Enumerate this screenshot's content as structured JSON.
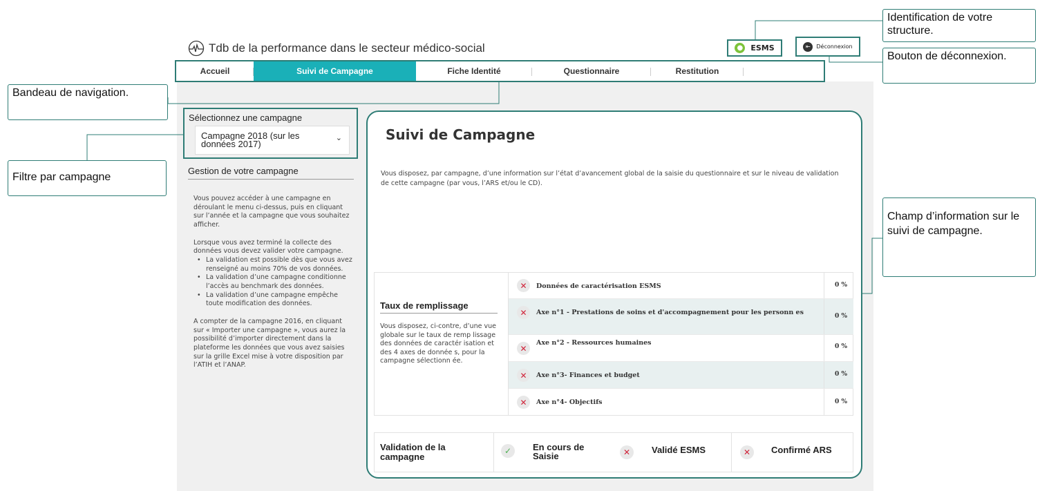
{
  "header": {
    "app_title": "Tdb de la performance dans le secteur médico-social",
    "esms_label": "ESMS",
    "logout_label": "Déconnexion"
  },
  "nav": {
    "tabs": [
      "Accueil",
      "Suivi de Campagne",
      "Fiche Identité",
      "Questionnaire",
      "Restitution"
    ],
    "active": "Suivi de Campagne"
  },
  "campaign_select": {
    "label": "Sélectionnez une campagne",
    "value": "Campagne 2018 (sur les données 2017)"
  },
  "gestion": {
    "title": "Gestion de votre campagne",
    "para1": "Vous pouvez accéder à une campagne en déroulant le menu ci-dessus, puis en cliquant sur l’année et la campagne que vous souhaitez afficher.",
    "para2": "Lorsque vous avez terminé la collecte des données vous devez valider votre campagne.",
    "bullets": [
      "La validation est possible dès que vous avez renseigné au moins 70% de vos données.",
      "La validation d’une campagne conditionne l’accès au benchmark des données.",
      "La validation d’une campagne empêche toute modification des données."
    ],
    "para3": "A compter de la campagne 2016, en cliquant sur « Importer une campagne », vous aurez la possibilité d’importer directement dans la plateforme les données que vous avez saisies sur la grille Excel mise à votre disposition par l’ATIH et l’ANAP."
  },
  "main": {
    "title": "Suivi de Campagne",
    "description": "Vous disposez, par campagne, d’une information sur l’état d’avancement global de la saisie du questionnaire et sur le niveau de validation de cette campagne (par vous, l’ARS et/ou le CD).",
    "fill": {
      "title": "Taux de remplissage",
      "text": "Vous disposez, ci-contre, d’une vue globale sur le taux de remp lissage des données de caractér isation et des 4 axes de donnée s, pour la campagne sélectionn ée.",
      "rows": [
        {
          "label": "Données de caractérisation ESMS",
          "percent": "0 %"
        },
        {
          "label": "Axe n°1 - Prestations de soins et d'accompagnement pour les personn es",
          "percent": "0 %"
        },
        {
          "label": "Axe n°2 - Ressources humaines",
          "percent": "0 %"
        },
        {
          "label": "Axe n°3- Finances et budget",
          "percent": "0 %"
        },
        {
          "label": "Axe n°4- Objectifs",
          "percent": "0 %"
        }
      ]
    },
    "validation": {
      "title": "Validation de la campagne",
      "statuses": [
        {
          "label": "En cours de Saisie",
          "state": "done"
        },
        {
          "label": "Validé ESMS",
          "state": "not-done"
        },
        {
          "label": "Confirmé ARS",
          "state": "not-done"
        }
      ]
    }
  },
  "annotations": {
    "identification": "Identification de votre structure.",
    "deconnexion": "Bouton de déconnexion.",
    "bandeau": "Bandeau de navigation.",
    "filtre": "Filtre par campagne",
    "champ": "Champ d’information sur le suivi de campagne."
  },
  "colors": {
    "accent": "#1ab0b8",
    "border": "#2e7c75",
    "error": "#d0243a",
    "success": "#4caf50"
  }
}
